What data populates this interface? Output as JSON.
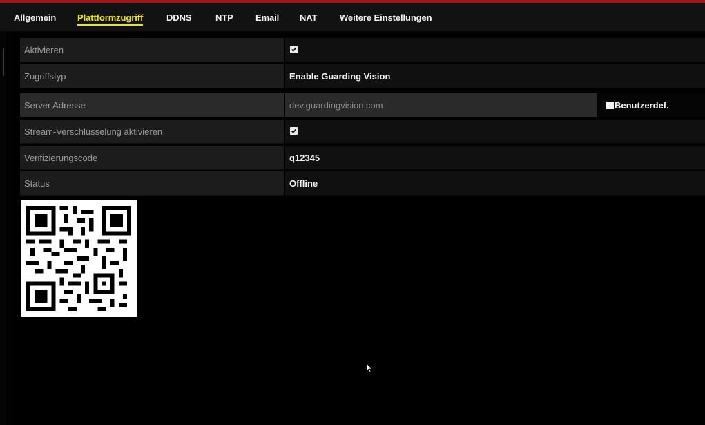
{
  "tabs": [
    {
      "label": "Allgemein",
      "active": false
    },
    {
      "label": "Plattformzugriff",
      "active": true
    },
    {
      "label": "DDNS",
      "active": false
    },
    {
      "label": "NTP",
      "active": false
    },
    {
      "label": "Email",
      "active": false
    },
    {
      "label": "NAT",
      "active": false
    },
    {
      "label": "Weitere Einstellungen",
      "active": false
    }
  ],
  "form": {
    "enable": {
      "label": "Aktivieren",
      "checked": true
    },
    "access_type": {
      "label": "Zugriffstyp",
      "value": "Enable Guarding Vision"
    },
    "server_address": {
      "label": "Server Adresse",
      "value": "dev.guardingvision.com",
      "custom_label": "Benutzerdef.",
      "custom_checked": false
    },
    "stream_encryption": {
      "label": "Stream-Verschlüsselung aktivieren",
      "checked": true
    },
    "verification_code": {
      "label": "Verifizierungscode",
      "value": "q12345"
    },
    "status": {
      "label": "Status",
      "value": "Offline"
    }
  },
  "colors": {
    "active_tab": "#f2e600",
    "accent_bar": "#a31414",
    "background": "#000000"
  }
}
